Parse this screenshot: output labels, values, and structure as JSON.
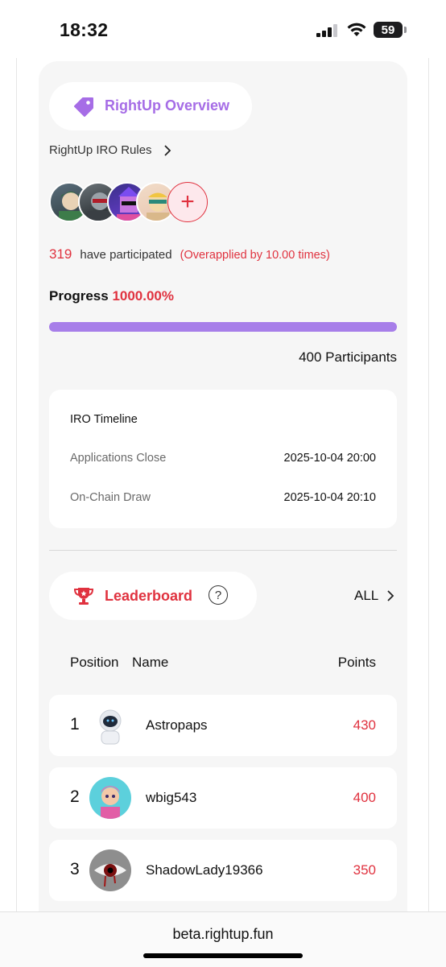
{
  "status_bar": {
    "time": "18:32",
    "battery": "59"
  },
  "overview": {
    "title": "RightUp Overview",
    "rules_link": "RightUp IRO Rules"
  },
  "participation": {
    "count": "319",
    "label": "have participated",
    "overapplied": "(Overapplied by 10.00 times)"
  },
  "progress": {
    "label": "Progress",
    "percent_text": "1000.00%",
    "bar_fill": 1.0
  },
  "participants_total": "400 Participants",
  "timeline": {
    "title": "IRO Timeline",
    "rows": [
      {
        "label": "Applications Close",
        "value": "2025-10-04 20:00"
      },
      {
        "label": "On-Chain Draw",
        "value": "2025-10-04 20:10"
      }
    ]
  },
  "leaderboard": {
    "title": "Leaderboard",
    "all_link": "ALL",
    "headers": {
      "position": "Position",
      "name": "Name",
      "points": "Points"
    },
    "rows": [
      {
        "rank": "1",
        "name": "Astropaps",
        "points": "430"
      },
      {
        "rank": "2",
        "name": "wbig543",
        "points": "400"
      },
      {
        "rank": "3",
        "name": "ShadowLady19366",
        "points": "350"
      }
    ]
  },
  "browser": {
    "url": "beta.rightup.fun"
  },
  "colors": {
    "accent_purple": "#a66de6",
    "accent_red": "#e0323f",
    "progress_fill": "#a77ee9"
  }
}
